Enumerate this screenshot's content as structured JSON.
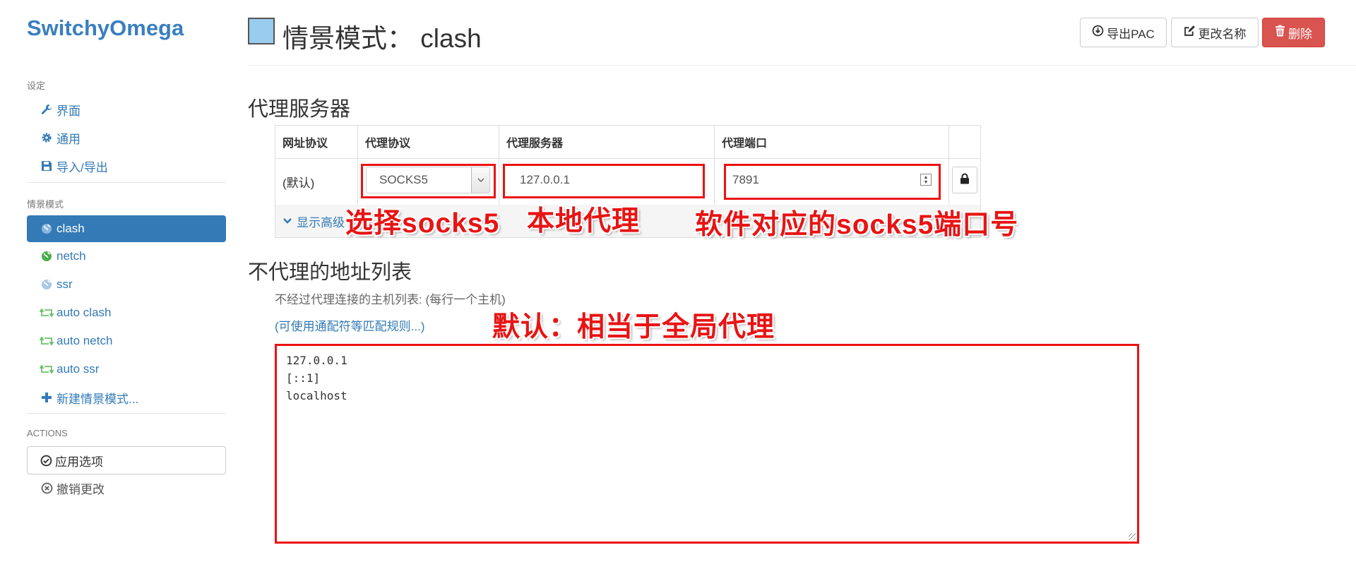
{
  "sidebar": {
    "brand": "SwitchyOmega",
    "settings_header": "设定",
    "settings_items": [
      {
        "label": "界面",
        "icon": "wrench-icon"
      },
      {
        "label": "通用",
        "icon": "gear-icon"
      },
      {
        "label": "导入/导出",
        "icon": "floppy-icon"
      }
    ],
    "profiles_header": "情景模式",
    "profiles": [
      {
        "label": "clash",
        "icon": "globe-icon",
        "active": true
      },
      {
        "label": "netch",
        "icon": "globe-icon",
        "active": false
      },
      {
        "label": "ssr",
        "icon": "globe-icon",
        "active": false
      },
      {
        "label": "auto clash",
        "icon": "retweet-icon",
        "active": false
      },
      {
        "label": "auto netch",
        "icon": "retweet-icon",
        "active": false
      },
      {
        "label": "auto ssr",
        "icon": "retweet-icon",
        "active": false
      }
    ],
    "new_profile": "新建情景模式...",
    "actions_header": "ACTIONS",
    "apply_label": "应用选项",
    "discard_label": "撤销更改"
  },
  "header": {
    "title": "情景模式： clash",
    "swatch_color": "#99ccee",
    "export_pac": "导出PAC",
    "rename": "更改名称",
    "delete": "删除"
  },
  "proxy": {
    "heading": "代理服务器",
    "columns": [
      "网址协议",
      "代理协议",
      "代理服务器",
      "代理端口"
    ],
    "row": {
      "scheme": "(默认)",
      "protocol": "SOCKS5",
      "server": "127.0.0.1",
      "port": "7891"
    },
    "advanced_label": "显示高级"
  },
  "bypass": {
    "heading": "不代理的地址列表",
    "help": "不经过代理连接的主机列表: (每行一个主机)",
    "wildcard_link": "(可使用通配符等匹配规则...)",
    "lines": [
      "127.0.0.1",
      "[::1]",
      "localhost"
    ]
  },
  "annotations": {
    "protocol": "选择socks5",
    "server": "本地代理",
    "port": "软件对应的socks5端口号",
    "bypass": "默认：相当于全局代理"
  },
  "colors": {
    "accent": "#337ab7",
    "danger": "#d9534f",
    "annotation": "#e81414"
  }
}
